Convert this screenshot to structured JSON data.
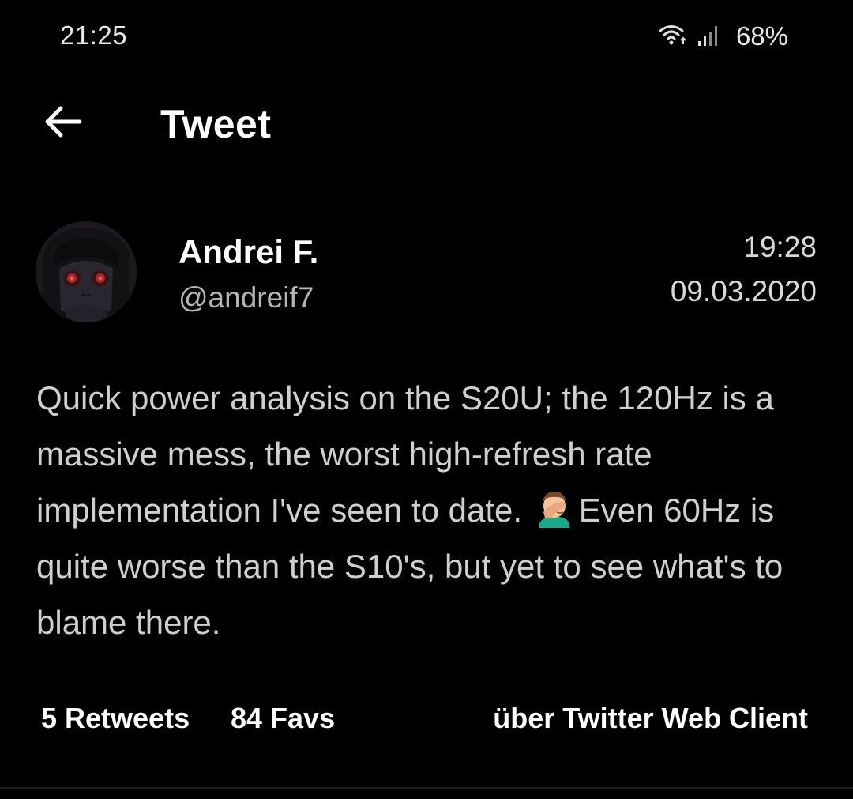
{
  "status_bar": {
    "time": "21:25",
    "battery": "68%",
    "icons": [
      "wifi-icon",
      "signal-icon"
    ]
  },
  "app_bar": {
    "back_icon": "arrow-left-icon",
    "title": "Tweet"
  },
  "tweet": {
    "author_name": "Andrei F.",
    "author_handle": "@andreif7",
    "time": "19:28",
    "date": "09.03.2020",
    "text_part1": "Quick power analysis on the S20U; the 120Hz is a massive mess, the worst high-refresh rate implementation I've seen to date.",
    "emoji": "facepalm-emoji",
    "text_part2": "Even 60Hz is quite worse than the S10's, but yet to see what's to blame there."
  },
  "stats": {
    "retweets": "5 Retweets",
    "favs": "84 Favs",
    "source": "über Twitter Web Client"
  },
  "colors": {
    "background": "#000000",
    "primary_text": "#ffffff",
    "body_text": "#cfcfcf",
    "secondary_text": "#b5b5b5"
  }
}
